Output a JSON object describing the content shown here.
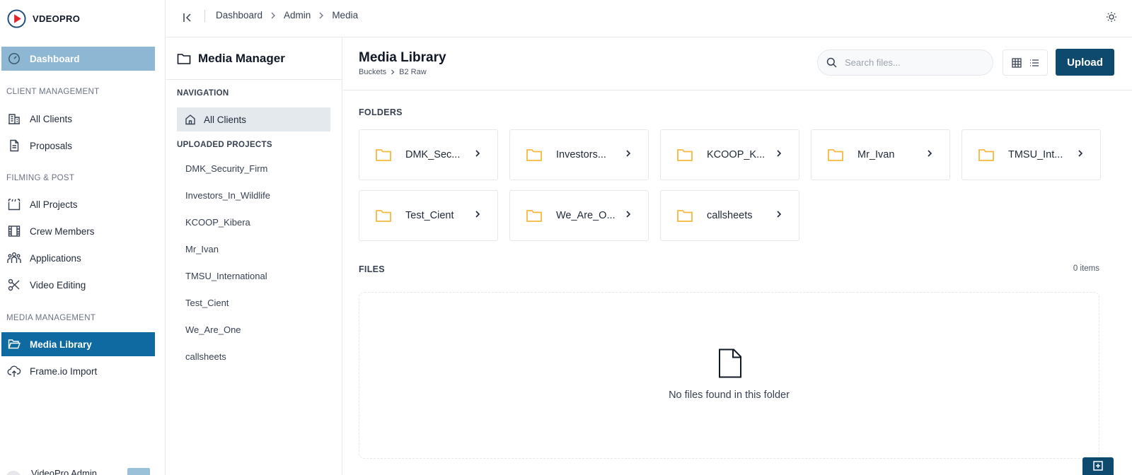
{
  "brand": {
    "name": "VDEOPRO",
    "color": "#e3252b"
  },
  "sidebar": {
    "dashboard": "Dashboard",
    "sections": {
      "client": "CLIENT MANAGEMENT",
      "filming": "FILMING & POST",
      "media": "MEDIA MANAGEMENT"
    },
    "items": {
      "all_clients": "All Clients",
      "proposals": "Proposals",
      "all_projects": "All Projects",
      "crew_members": "Crew Members",
      "applications": "Applications",
      "video_editing": "Video Editing",
      "media_library": "Media Library",
      "frameio_import": "Frame.io Import"
    },
    "user": {
      "name": "VideoPro Admin"
    }
  },
  "topbar": {
    "breadcrumb": [
      "Dashboard",
      "Admin",
      "Media"
    ]
  },
  "media_manager": {
    "title": "Media Manager",
    "navigation_label": "NAVIGATION",
    "nav_all_clients": "All Clients",
    "uploaded_label": "UPLOADED PROJECTS",
    "projects": [
      "DMK_Security_Firm",
      "Investors_In_Wildlife",
      "KCOOP_Kibera",
      "Mr_Ivan",
      "TMSU_International",
      "Test_Cient",
      "We_Are_One",
      "callsheets"
    ]
  },
  "library": {
    "title": "Media Library",
    "crumbs": [
      "Buckets",
      "B2 Raw"
    ],
    "search_placeholder": "Search files...",
    "upload_label": "Upload",
    "folders_label": "FOLDERS",
    "folders": [
      "DMK_Sec...",
      "Investors...",
      "KCOOP_K...",
      "Mr_Ivan",
      "TMSU_Int...",
      "Test_Cient",
      "We_Are_O...",
      "callsheets"
    ],
    "files_label": "FILES",
    "files_count": "0 items",
    "empty_message": "No files found in this folder"
  },
  "colors": {
    "primary": "#0d4a6e",
    "active_nav": "#0e6aa0",
    "dashboard_highlight": "#8db7d2",
    "folder_icon": "#f5b83d"
  },
  "icons": {
    "dashboard": "gauge-icon",
    "all_clients": "building-icon",
    "proposals": "document-icon",
    "all_projects": "clapperboard-icon",
    "crew_members": "film-icon",
    "applications": "people-icon",
    "video_editing": "scissors-icon",
    "media_library": "folder-open-icon",
    "frameio_import": "cloud-upload-icon",
    "collapse": "collapse-left-icon",
    "theme": "sun-icon",
    "search": "search-icon",
    "grid": "grid-icon",
    "list": "list-icon",
    "folder": "folder-icon",
    "empty_file": "file-icon"
  }
}
